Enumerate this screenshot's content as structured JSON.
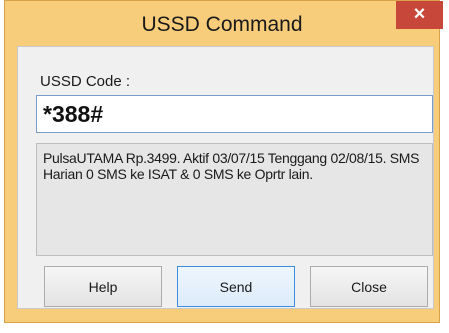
{
  "window": {
    "title": "USSD Command",
    "close_glyph": "×"
  },
  "form": {
    "code_label": "USSD Code :",
    "code_value": "*388#",
    "response_text": "PulsaUTAMA Rp.3499. Aktif 03/07/15 Tenggang 02/08/15. SMS Harian 0 SMS ke ISAT & 0 SMS ke Oprtr lain."
  },
  "buttons": {
    "help": "Help",
    "send": "Send",
    "close": "Close"
  },
  "colors": {
    "frame": "#f7cc7a",
    "close_button": "#c7473b",
    "focus_border": "#3c8de0"
  },
  "icons": {
    "close": "close-icon"
  }
}
